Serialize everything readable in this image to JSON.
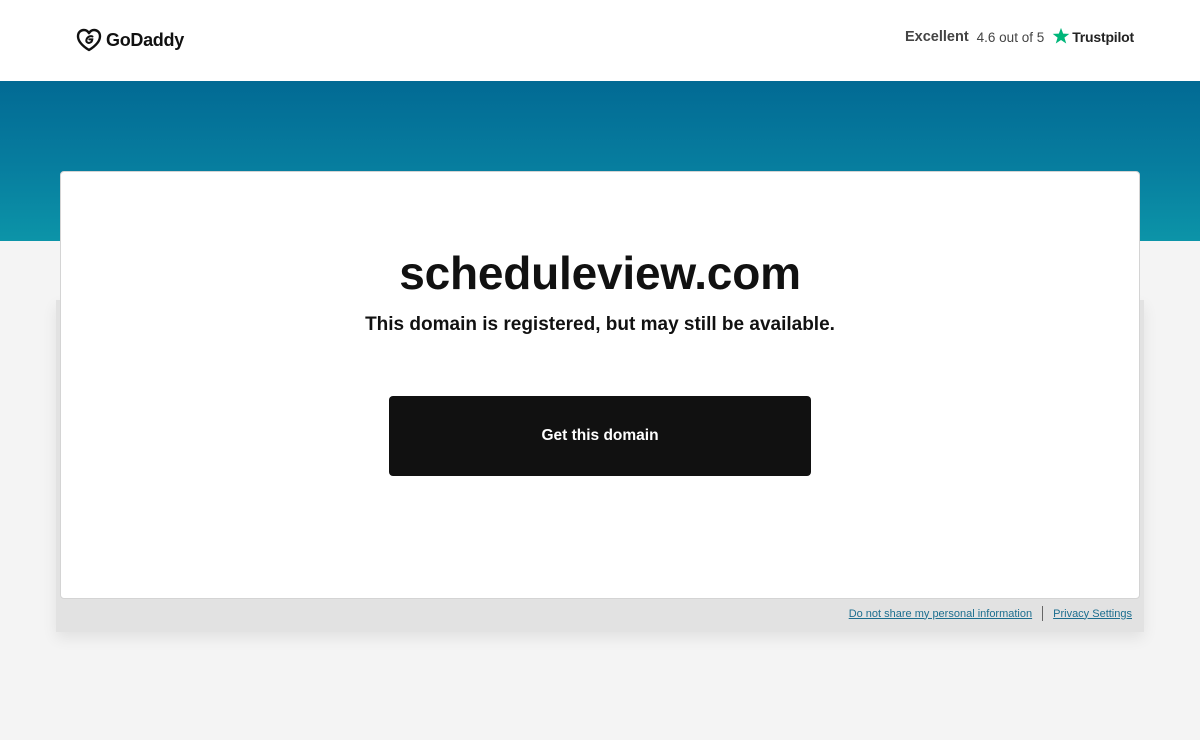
{
  "header": {
    "logo_text": "GoDaddy",
    "trustpilot": {
      "rating_word": "Excellent",
      "score_text": "4.6 out of 5",
      "brand": "Trustpilot"
    }
  },
  "main": {
    "domain": "scheduleview.com",
    "subtitle": "This domain is registered, but may still be available.",
    "cta_label": "Get this domain"
  },
  "footer": {
    "privacy_opt_out": "Do not share my personal information",
    "privacy_settings": "Privacy Settings"
  },
  "colors": {
    "band_top": "#026a94",
    "band_bottom": "#0c94a8",
    "cta_bg": "#111111",
    "trustpilot_green": "#00b67a",
    "link": "#1c6e8f"
  },
  "icons": [
    "godaddy-logo-icon",
    "trustpilot-star-icon"
  ]
}
